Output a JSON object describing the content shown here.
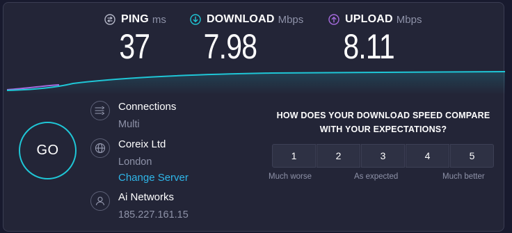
{
  "metrics": {
    "ping": {
      "label": "PING",
      "unit": "ms",
      "value": "37",
      "icon": "ping-icon",
      "color": "#b5b8c8"
    },
    "download": {
      "label": "DOWNLOAD",
      "unit": "Mbps",
      "value": "7.98",
      "icon": "download-arrow-icon",
      "color": "#1fc6d6"
    },
    "upload": {
      "label": "UPLOAD",
      "unit": "Mbps",
      "value": "8.11",
      "icon": "upload-arrow-icon",
      "color": "#a56bde"
    }
  },
  "go_button": {
    "label": "GO",
    "color": "#1fc6d6"
  },
  "connections": {
    "label": "Connections",
    "mode": "Multi",
    "icon": "connections-icon"
  },
  "server": {
    "name": "Coreix Ltd",
    "location": "London",
    "change_link": "Change Server",
    "icon": "globe-icon"
  },
  "isp": {
    "name": "Ai Networks",
    "ip": "185.227.161.15",
    "icon": "user-icon"
  },
  "survey": {
    "question": "HOW DOES YOUR DOWNLOAD SPEED COMPARE WITH YOUR EXPECTATIONS?",
    "options": [
      "1",
      "2",
      "3",
      "4",
      "5"
    ],
    "scale": {
      "low": "Much worse",
      "mid": "As expected",
      "high": "Much better"
    }
  },
  "colors": {
    "background": "#181a2e",
    "panel": "#232537",
    "accent": "#1fc6d6",
    "upload": "#a56bde",
    "link": "#2fb6e9"
  }
}
